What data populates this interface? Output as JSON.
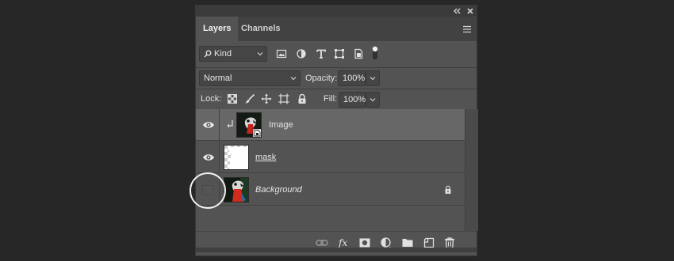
{
  "panel": {
    "tabs": [
      {
        "label": "Layers",
        "active": true
      },
      {
        "label": "Channels",
        "active": false
      }
    ],
    "strip": {
      "collapse_icon": "double-chevron-left-icon",
      "close_icon": "close-icon"
    },
    "menu_icon": "hamburger-menu-icon"
  },
  "filter": {
    "kind_label": "Kind",
    "filter_icons": [
      "pixel-filter-icon",
      "adjustment-filter-icon",
      "type-filter-icon",
      "shape-filter-icon",
      "smart-object-filter-icon",
      "filter-toggle-icon"
    ]
  },
  "blend": {
    "mode": "Normal",
    "opacity_label": "Opacity:",
    "opacity_value": "100%"
  },
  "lock": {
    "label": "Lock:",
    "icons": [
      "lock-transparent-pixels-icon",
      "lock-image-pixels-icon",
      "lock-position-icon",
      "lock-artboard-icon",
      "lock-all-icon"
    ],
    "fill_label": "Fill:",
    "fill_value": "100%"
  },
  "layers": [
    {
      "name": "Image",
      "visible": true,
      "selected": true,
      "clipped": true,
      "style": "normal"
    },
    {
      "name": "mask",
      "visible": true,
      "selected": false,
      "clipped": false,
      "style": "underline"
    },
    {
      "name": "Background",
      "visible": false,
      "selected": false,
      "clipped": false,
      "style": "italic",
      "locked": true
    }
  ],
  "footer_icons": [
    "link-layers-icon",
    "fx-icon",
    "add-mask-icon",
    "adjustment-layer-icon",
    "new-group-icon",
    "new-layer-icon",
    "delete-layer-icon"
  ],
  "colors": {
    "panel": "#535353",
    "background": "#272727",
    "selected_row": "#676767",
    "tabbar": "#424242"
  }
}
